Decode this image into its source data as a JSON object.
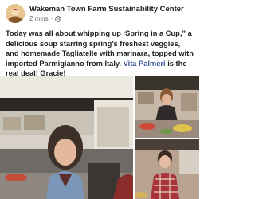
{
  "post": {
    "page_name": "Wakeman Town Farm Sustainability Center",
    "time": "2 mins",
    "separator": "·",
    "text_before_mention": "Today was all about whipping up ‘Spring in a Cup,” a delicious soup starring spring’s freshest veggies, and homemade Tagliatelle with marinara, topped with imported Parmigianno from Italy. ",
    "mention": "Vita Palmeri",
    "text_after_mention": " is the real deal! Gracie!"
  },
  "icons": {
    "avatar": "farm-logo-icon",
    "privacy": "globe-icon"
  },
  "colors": {
    "text": "#1c1e21",
    "meta": "#65676b",
    "mention": "#385898"
  }
}
